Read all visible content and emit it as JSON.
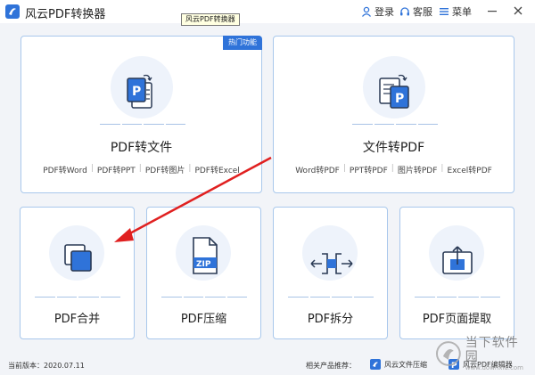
{
  "app": {
    "title": "风云PDF转换器",
    "tooltip": "风云PDF转换器"
  },
  "titlebar": {
    "login_label": "登录",
    "service_label": "客服",
    "menu_label": "菜单"
  },
  "cards": {
    "pdf_to_file": {
      "title": "PDF转文件",
      "badge": "热门功能",
      "links": [
        "PDF转Word",
        "PDF转PPT",
        "PDF转图片",
        "PDF转Excel"
      ]
    },
    "file_to_pdf": {
      "title": "文件转PDF",
      "links": [
        "Word转PDF",
        "PPT转PDF",
        "图片转PDF",
        "Excel转PDF"
      ]
    },
    "merge": {
      "title": "PDF合并"
    },
    "compress": {
      "title": "PDF压缩",
      "icon_text": "ZIP"
    },
    "split": {
      "title": "PDF拆分"
    },
    "extract": {
      "title": "PDF页面提取"
    }
  },
  "statusbar": {
    "version": "当前版本：2020.07.11",
    "recommend_label": "相关产品推荐：",
    "product_1": "风云文件压缩",
    "product_2": "风云PDF编辑器"
  },
  "watermark": {
    "cn": "当下软件园",
    "en": "www.downxia.com"
  },
  "colors": {
    "accent": "#2f73d9",
    "card_border": "#a9c8ec",
    "arrow": "#e02020"
  }
}
